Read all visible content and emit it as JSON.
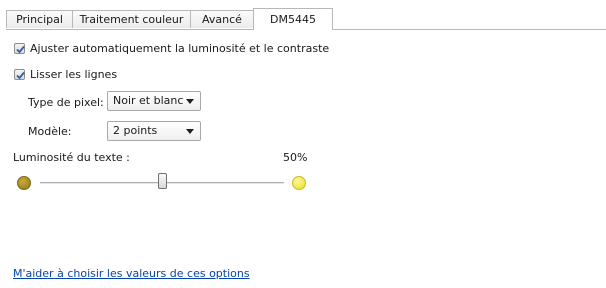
{
  "tabs": [
    {
      "label": "Principal"
    },
    {
      "label": "Traitement couleur"
    },
    {
      "label": "Avancé"
    },
    {
      "label": "DM5445",
      "active": true
    }
  ],
  "options": {
    "auto_brightness": {
      "label": "Ajuster automatiquement la luminosité et le contraste",
      "checked": true
    },
    "smooth_lines": {
      "label": "Lisser les lignes",
      "checked": true
    }
  },
  "pixel_type": {
    "label": "Type de pixel:",
    "value": "Noir et blanc"
  },
  "model": {
    "label": "Modèle:",
    "value": "2 points"
  },
  "text_brightness": {
    "label": "Luminosité du texte :",
    "value_text": "50%",
    "value": 50
  },
  "help_link": "M'aider à choisir les valeurs de ces options",
  "colors": {
    "link": "#0645ad",
    "check": "#2a5fb0"
  }
}
